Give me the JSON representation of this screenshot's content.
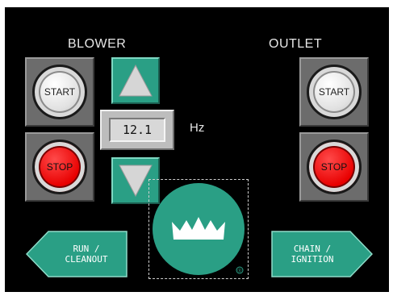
{
  "blower": {
    "title": "BLOWER",
    "start_label": "START",
    "stop_label": "STOP"
  },
  "outlet": {
    "title": "OUTLET",
    "start_label": "START",
    "stop_label": "STOP"
  },
  "frequency": {
    "value": "12.1",
    "unit": "Hz"
  },
  "nav": {
    "left_label": "RUN /\nCLEANOUT",
    "right_label": "CHAIN /\nIGNITION"
  },
  "logo": {
    "icon": "crown-icon",
    "mark": "®"
  },
  "colors": {
    "background": "#000000",
    "teal": "#2a9f85",
    "stop_red": "#e80000",
    "start_grey": "#e2e2e2"
  }
}
